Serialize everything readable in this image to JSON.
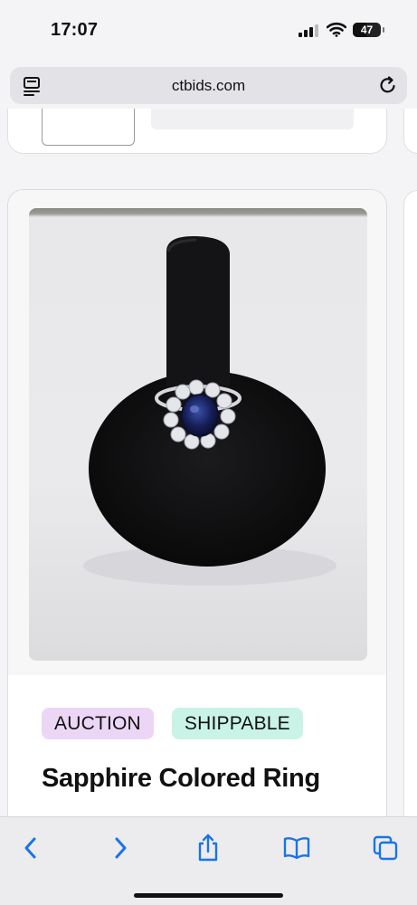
{
  "status_bar": {
    "time": "17:07",
    "battery_level": "47",
    "icons": [
      "signal-icon",
      "wifi-icon",
      "battery-icon"
    ]
  },
  "browser": {
    "url": "ctbids.com",
    "tabs_icon": "tab-overview-icon",
    "reload_icon": "reload-icon"
  },
  "listing": {
    "image_alt": "Sapphire colored ring on black velvet display stand",
    "badges": {
      "auction": "AUCTION",
      "shippable": "SHIPPABLE"
    },
    "title": "Sapphire Colored Ring"
  },
  "toolbar": {
    "buttons": [
      "back-icon",
      "forward-icon",
      "share-icon",
      "bookmarks-icon",
      "tabs-icon"
    ]
  },
  "colors": {
    "accent": "#1a73e8",
    "badge_auction_bg": "#ecd6f6",
    "badge_shippable_bg": "#c9f3e6"
  }
}
